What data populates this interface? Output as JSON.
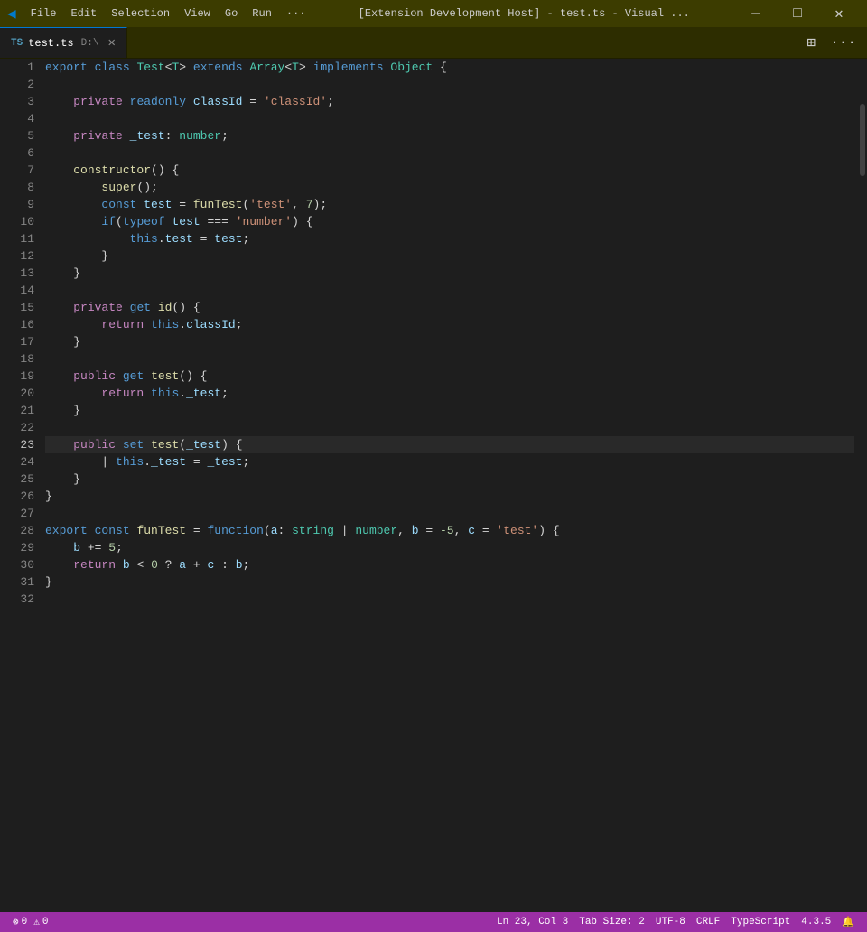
{
  "titlebar": {
    "logo": "◀",
    "menus": [
      "File",
      "Edit",
      "Selection",
      "View",
      "Go",
      "Run",
      "···"
    ],
    "title": "[Extension Development Host] - test.ts - Visual ...",
    "controls": {
      "minimize": "—",
      "maximize": "□",
      "close": "✕"
    }
  },
  "tabbar": {
    "tabs": [
      {
        "icon": "TS",
        "label": "test.ts",
        "path": "D:\\",
        "active": true
      }
    ],
    "right_buttons": [
      "⊡",
      "···"
    ]
  },
  "editor": {
    "lines": [
      {
        "num": 1,
        "tokens": [
          {
            "t": "kw",
            "v": "export"
          },
          {
            "t": "plain",
            "v": " "
          },
          {
            "t": "kw",
            "v": "class"
          },
          {
            "t": "plain",
            "v": " "
          },
          {
            "t": "type",
            "v": "Test"
          },
          {
            "t": "plain",
            "v": "<"
          },
          {
            "t": "type",
            "v": "T"
          },
          {
            "t": "plain",
            "v": "> "
          },
          {
            "t": "kw",
            "v": "extends"
          },
          {
            "t": "plain",
            "v": " "
          },
          {
            "t": "type",
            "v": "Array"
          },
          {
            "t": "plain",
            "v": "<"
          },
          {
            "t": "type",
            "v": "T"
          },
          {
            "t": "plain",
            "v": "> "
          },
          {
            "t": "kw",
            "v": "implements"
          },
          {
            "t": "plain",
            "v": " "
          },
          {
            "t": "type",
            "v": "Object"
          },
          {
            "t": "plain",
            "v": " {"
          }
        ]
      },
      {
        "num": 2,
        "tokens": []
      },
      {
        "num": 3,
        "tokens": [
          {
            "t": "plain",
            "v": "    "
          },
          {
            "t": "kw2",
            "v": "private"
          },
          {
            "t": "plain",
            "v": " "
          },
          {
            "t": "kw",
            "v": "readonly"
          },
          {
            "t": "plain",
            "v": " "
          },
          {
            "t": "prop",
            "v": "classId"
          },
          {
            "t": "plain",
            "v": " = "
          },
          {
            "t": "str",
            "v": "'classId'"
          },
          {
            "t": "plain",
            "v": ";"
          }
        ]
      },
      {
        "num": 4,
        "tokens": []
      },
      {
        "num": 5,
        "tokens": [
          {
            "t": "plain",
            "v": "    "
          },
          {
            "t": "kw2",
            "v": "private"
          },
          {
            "t": "plain",
            "v": " "
          },
          {
            "t": "prop",
            "v": "_test"
          },
          {
            "t": "plain",
            "v": ": "
          },
          {
            "t": "type",
            "v": "number"
          },
          {
            "t": "plain",
            "v": ";"
          }
        ]
      },
      {
        "num": 6,
        "tokens": []
      },
      {
        "num": 7,
        "tokens": [
          {
            "t": "plain",
            "v": "    "
          },
          {
            "t": "fn",
            "v": "constructor"
          },
          {
            "t": "plain",
            "v": "() {"
          }
        ]
      },
      {
        "num": 8,
        "tokens": [
          {
            "t": "plain",
            "v": "        "
          },
          {
            "t": "fn",
            "v": "super"
          },
          {
            "t": "plain",
            "v": "();"
          }
        ]
      },
      {
        "num": 9,
        "tokens": [
          {
            "t": "plain",
            "v": "        "
          },
          {
            "t": "kw",
            "v": "const"
          },
          {
            "t": "plain",
            "v": " "
          },
          {
            "t": "prop",
            "v": "test"
          },
          {
            "t": "plain",
            "v": " = "
          },
          {
            "t": "fn",
            "v": "funTest"
          },
          {
            "t": "plain",
            "v": "("
          },
          {
            "t": "str",
            "v": "'test'"
          },
          {
            "t": "plain",
            "v": ", "
          },
          {
            "t": "num",
            "v": "7"
          },
          {
            "t": "plain",
            "v": ");"
          }
        ]
      },
      {
        "num": 10,
        "tokens": [
          {
            "t": "plain",
            "v": "        "
          },
          {
            "t": "kw",
            "v": "if"
          },
          {
            "t": "plain",
            "v": "("
          },
          {
            "t": "kw",
            "v": "typeof"
          },
          {
            "t": "plain",
            "v": " "
          },
          {
            "t": "prop",
            "v": "test"
          },
          {
            "t": "plain",
            "v": " === "
          },
          {
            "t": "str",
            "v": "'number'"
          },
          {
            "t": "plain",
            "v": ") {"
          }
        ]
      },
      {
        "num": 11,
        "tokens": [
          {
            "t": "plain",
            "v": "            "
          },
          {
            "t": "kw",
            "v": "this"
          },
          {
            "t": "plain",
            "v": "."
          },
          {
            "t": "prop",
            "v": "test"
          },
          {
            "t": "plain",
            "v": " = "
          },
          {
            "t": "prop",
            "v": "test"
          },
          {
            "t": "plain",
            "v": ";"
          }
        ]
      },
      {
        "num": 12,
        "tokens": [
          {
            "t": "plain",
            "v": "        }"
          }
        ]
      },
      {
        "num": 13,
        "tokens": [
          {
            "t": "plain",
            "v": "    }"
          }
        ]
      },
      {
        "num": 14,
        "tokens": []
      },
      {
        "num": 15,
        "tokens": [
          {
            "t": "plain",
            "v": "    "
          },
          {
            "t": "kw2",
            "v": "private"
          },
          {
            "t": "plain",
            "v": " "
          },
          {
            "t": "kw",
            "v": "get"
          },
          {
            "t": "plain",
            "v": " "
          },
          {
            "t": "fn",
            "v": "id"
          },
          {
            "t": "plain",
            "v": "() {"
          }
        ]
      },
      {
        "num": 16,
        "tokens": [
          {
            "t": "plain",
            "v": "        "
          },
          {
            "t": "kw2",
            "v": "return"
          },
          {
            "t": "plain",
            "v": " "
          },
          {
            "t": "kw",
            "v": "this"
          },
          {
            "t": "plain",
            "v": "."
          },
          {
            "t": "prop",
            "v": "classId"
          },
          {
            "t": "plain",
            "v": ";"
          }
        ]
      },
      {
        "num": 17,
        "tokens": [
          {
            "t": "plain",
            "v": "    }"
          }
        ]
      },
      {
        "num": 18,
        "tokens": []
      },
      {
        "num": 19,
        "tokens": [
          {
            "t": "plain",
            "v": "    "
          },
          {
            "t": "kw2",
            "v": "public"
          },
          {
            "t": "plain",
            "v": " "
          },
          {
            "t": "kw",
            "v": "get"
          },
          {
            "t": "plain",
            "v": " "
          },
          {
            "t": "fn",
            "v": "test"
          },
          {
            "t": "plain",
            "v": "() {"
          }
        ]
      },
      {
        "num": 20,
        "tokens": [
          {
            "t": "plain",
            "v": "        "
          },
          {
            "t": "kw2",
            "v": "return"
          },
          {
            "t": "plain",
            "v": " "
          },
          {
            "t": "kw",
            "v": "this"
          },
          {
            "t": "plain",
            "v": "."
          },
          {
            "t": "prop",
            "v": "_test"
          },
          {
            "t": "plain",
            "v": ";"
          }
        ]
      },
      {
        "num": 21,
        "tokens": [
          {
            "t": "plain",
            "v": "    }"
          }
        ]
      },
      {
        "num": 22,
        "tokens": []
      },
      {
        "num": 23,
        "tokens": [
          {
            "t": "plain",
            "v": "    "
          },
          {
            "t": "kw2",
            "v": "public"
          },
          {
            "t": "plain",
            "v": " "
          },
          {
            "t": "kw",
            "v": "set"
          },
          {
            "t": "plain",
            "v": " "
          },
          {
            "t": "fn",
            "v": "test"
          },
          {
            "t": "plain",
            "v": "("
          },
          {
            "t": "param",
            "v": "_test"
          },
          {
            "t": "plain",
            "v": ") {"
          }
        ],
        "active": true
      },
      {
        "num": 24,
        "tokens": [
          {
            "t": "plain",
            "v": "        | "
          },
          {
            "t": "kw",
            "v": "this"
          },
          {
            "t": "plain",
            "v": "."
          },
          {
            "t": "prop",
            "v": "_test"
          },
          {
            "t": "plain",
            "v": " = "
          },
          {
            "t": "prop",
            "v": "_test"
          },
          {
            "t": "plain",
            "v": ";"
          }
        ]
      },
      {
        "num": 25,
        "tokens": [
          {
            "t": "plain",
            "v": "    }"
          }
        ]
      },
      {
        "num": 26,
        "tokens": [
          {
            "t": "plain",
            "v": "}"
          }
        ]
      },
      {
        "num": 27,
        "tokens": []
      },
      {
        "num": 28,
        "tokens": [
          {
            "t": "kw",
            "v": "export"
          },
          {
            "t": "plain",
            "v": " "
          },
          {
            "t": "kw",
            "v": "const"
          },
          {
            "t": "plain",
            "v": " "
          },
          {
            "t": "fn",
            "v": "funTest"
          },
          {
            "t": "plain",
            "v": " = "
          },
          {
            "t": "kw",
            "v": "function"
          },
          {
            "t": "plain",
            "v": "("
          },
          {
            "t": "param",
            "v": "a"
          },
          {
            "t": "plain",
            "v": ": "
          },
          {
            "t": "type",
            "v": "string"
          },
          {
            "t": "plain",
            "v": " | "
          },
          {
            "t": "type",
            "v": "number"
          },
          {
            "t": "plain",
            "v": ", "
          },
          {
            "t": "param",
            "v": "b"
          },
          {
            "t": "plain",
            "v": " = "
          },
          {
            "t": "num",
            "v": "-5"
          },
          {
            "t": "plain",
            "v": ", "
          },
          {
            "t": "param",
            "v": "c"
          },
          {
            "t": "plain",
            "v": " = "
          },
          {
            "t": "str",
            "v": "'test'"
          },
          {
            "t": "plain",
            "v": ") {"
          }
        ]
      },
      {
        "num": 29,
        "tokens": [
          {
            "t": "plain",
            "v": "    "
          },
          {
            "t": "prop",
            "v": "b"
          },
          {
            "t": "plain",
            "v": " += "
          },
          {
            "t": "num",
            "v": "5"
          },
          {
            "t": "plain",
            "v": ";"
          }
        ]
      },
      {
        "num": 30,
        "tokens": [
          {
            "t": "plain",
            "v": "    "
          },
          {
            "t": "kw2",
            "v": "return"
          },
          {
            "t": "plain",
            "v": " "
          },
          {
            "t": "prop",
            "v": "b"
          },
          {
            "t": "plain",
            "v": " < "
          },
          {
            "t": "num",
            "v": "0"
          },
          {
            "t": "plain",
            "v": " ? "
          },
          {
            "t": "prop",
            "v": "a"
          },
          {
            "t": "plain",
            "v": " + "
          },
          {
            "t": "prop",
            "v": "c"
          },
          {
            "t": "plain",
            "v": " : "
          },
          {
            "t": "prop",
            "v": "b"
          },
          {
            "t": "plain",
            "v": ";"
          }
        ]
      },
      {
        "num": 31,
        "tokens": [
          {
            "t": "plain",
            "v": "}"
          }
        ]
      },
      {
        "num": 32,
        "tokens": []
      }
    ]
  },
  "statusbar": {
    "left": [
      {
        "icon": "⊗",
        "label": "0"
      },
      {
        "icon": "⚠",
        "label": "0"
      }
    ],
    "right": [
      {
        "label": "Ln 23, Col 3"
      },
      {
        "label": "Tab Size: 2"
      },
      {
        "label": "UTF-8"
      },
      {
        "label": "CRLF"
      },
      {
        "label": "TypeScript"
      },
      {
        "label": "4.3.5"
      },
      {
        "icon": "🔔"
      },
      {
        "icon": "🔔"
      }
    ]
  }
}
